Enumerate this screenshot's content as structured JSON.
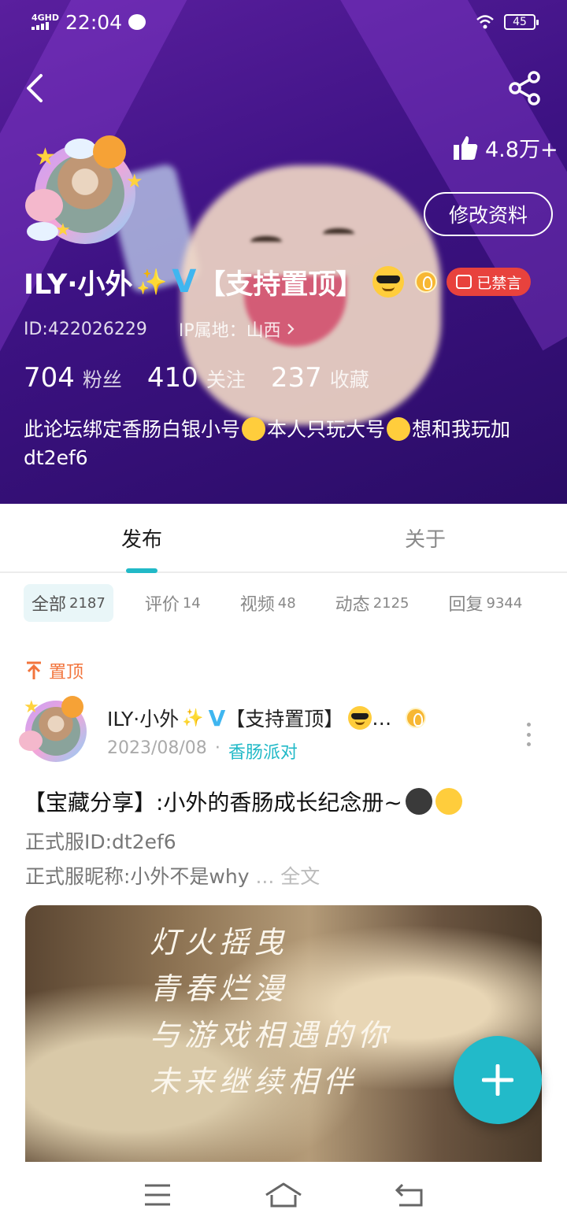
{
  "status_bar": {
    "network": "4GHD",
    "time": "22:04",
    "battery": "45",
    "icons": [
      "signal-icon",
      "wechat-icon",
      "wifi-icon",
      "battery-icon"
    ]
  },
  "header": {
    "likes": "4.8万+",
    "edit_button": "修改资料",
    "name": "ILY·小外",
    "badge_text": "【支持置顶】",
    "banned_label": "已禁言",
    "id_text": "ID:422026229",
    "ip_text": "IP属地：山西",
    "stats": [
      {
        "num": "704",
        "label": "粉丝"
      },
      {
        "num": "410",
        "label": "关注"
      },
      {
        "num": "237",
        "label": "收藏"
      }
    ],
    "bio_part1": "此论坛绑定香肠白银小号",
    "bio_part2": "本人只玩大号",
    "bio_part3": "想和我玩加dt2ef6"
  },
  "tabs": [
    {
      "label": "发布",
      "active": true
    },
    {
      "label": "关于",
      "active": false
    }
  ],
  "filters": [
    {
      "label": "全部",
      "count": "2187",
      "active": true
    },
    {
      "label": "评价",
      "count": "14",
      "active": false
    },
    {
      "label": "视频",
      "count": "48",
      "active": false
    },
    {
      "label": "动态",
      "count": "2125",
      "active": false
    },
    {
      "label": "回复",
      "count": "9344",
      "active": false
    }
  ],
  "post": {
    "pinned_label": "置顶",
    "author": "ILY·小外",
    "author_badge": "【支持置顶】",
    "ellipsis": "…",
    "date": "2023/08/08",
    "channel": "香肠派对",
    "title": "【宝藏分享】:小外的香肠成长纪念册~",
    "line1": "正式服ID:dt2ef6",
    "line2": "正式服昵称:小外不是why",
    "line2_more": " ... ",
    "full_text": "全文",
    "image_poem": [
      "灯火摇曳",
      "青春烂漫",
      "与游戏相遇的你",
      "未来继续相伴"
    ]
  },
  "colors": {
    "accent": "#22bac9",
    "header_bg": "#3d1283",
    "banned_red": "#e8423d",
    "pinned_orange": "#f2743c"
  }
}
